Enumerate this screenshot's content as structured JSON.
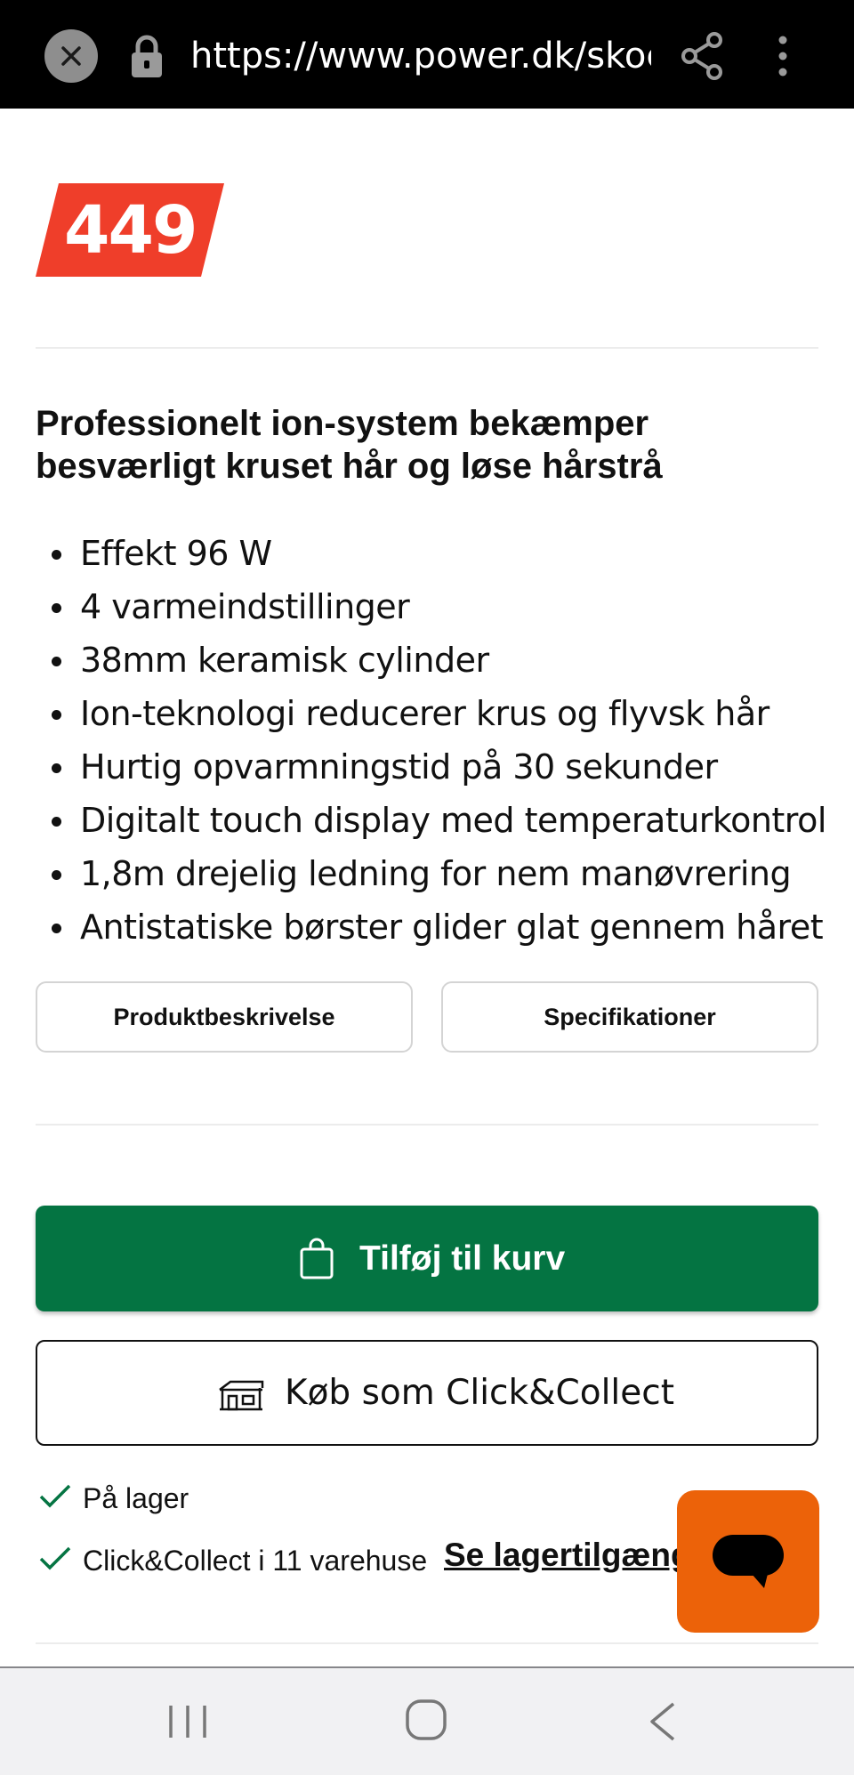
{
  "browser": {
    "url": "https://www.power.dk/skoen"
  },
  "product": {
    "price": "449",
    "headline": "Professionelt ion-system bekæmper besværligt kruset hår og løse hårstrå",
    "features": [
      "Effekt 96 W",
      "4 varmeindstillinger",
      "38mm keramisk cylinder",
      "Ion-teknologi reducerer krus og flyvsk hår",
      "Hurtig opvarmningstid på 30 sekunder",
      "Digitalt touch display med temperaturkontrol",
      "1,8m drejelig ledning for nem manøvrering",
      "Antistatiske børster glider glat gennem håret"
    ],
    "tabs": {
      "description": "Produktbeskrivelse",
      "specifications": "Specifikationer"
    }
  },
  "actions": {
    "add_to_cart": "Tilføj til kurv",
    "click_collect": "Køb som Click&Collect"
  },
  "stock": {
    "in_stock": "På lager",
    "click_collect_availability": "Click&Collect i 11 varehuse",
    "see_availability_link": "Se lagertilgæng"
  },
  "colors": {
    "price_badge": "#ef3e2a",
    "cart_button": "#047442",
    "chat_button": "#ec6209",
    "check": "#047442"
  },
  "icons": {
    "close": "close-icon",
    "lock": "lock-icon",
    "share": "share-icon",
    "more": "more-vertical-icon",
    "bag": "shopping-bag-icon",
    "store": "store-icon",
    "check": "check-icon",
    "chat": "chat-bubble-icon"
  }
}
